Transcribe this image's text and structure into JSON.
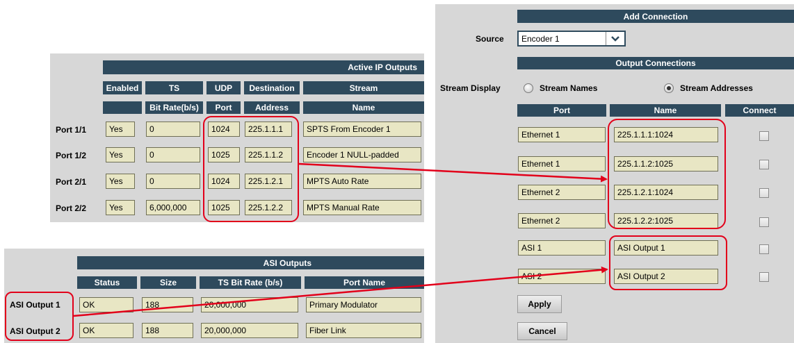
{
  "ip_outputs": {
    "title": "Active IP Outputs",
    "columns": [
      {
        "top": "Enabled",
        "bottom": ""
      },
      {
        "top": "TS",
        "bottom": "Bit Rate(b/s)"
      },
      {
        "top": "UDP",
        "bottom": "Port"
      },
      {
        "top": "Destination",
        "bottom": "Address"
      },
      {
        "top": "Stream",
        "bottom": "Name"
      }
    ],
    "rows": [
      {
        "label": "Port 1/1",
        "enabled": "Yes",
        "bitrate": "0",
        "udp": "1024",
        "address": "225.1.1.1",
        "name": "SPTS From Encoder 1"
      },
      {
        "label": "Port 1/2",
        "enabled": "Yes",
        "bitrate": "0",
        "udp": "1025",
        "address": "225.1.1.2",
        "name": "Encoder 1 NULL-padded"
      },
      {
        "label": "Port 2/1",
        "enabled": "Yes",
        "bitrate": "0",
        "udp": "1024",
        "address": "225.1.2.1",
        "name": "MPTS Auto Rate"
      },
      {
        "label": "Port 2/2",
        "enabled": "Yes",
        "bitrate": "6,000,000",
        "udp": "1025",
        "address": "225.1.2.2",
        "name": "MPTS Manual Rate"
      }
    ]
  },
  "asi_outputs": {
    "title": "ASI Outputs",
    "columns": [
      "Status",
      "Size",
      "TS Bit Rate (b/s)",
      "Port Name"
    ],
    "rows": [
      {
        "label": "ASI Output 1",
        "status": "OK",
        "size": "188",
        "bitrate": "20,000,000",
        "port_name": "Primary Modulator"
      },
      {
        "label": "ASI Output 2",
        "status": "OK",
        "size": "188",
        "bitrate": "20,000,000",
        "port_name": "Fiber Link"
      }
    ]
  },
  "add_connection": {
    "title": "Add Connection",
    "source_label": "Source",
    "source_value": "Encoder 1",
    "output_connections_title": "Output Connections",
    "stream_display_label": "Stream Display",
    "radio_names": "Stream Names",
    "radio_addresses": "Stream Addresses",
    "selected_display": "Stream Addresses",
    "columns": [
      "Port",
      "Name",
      "Connect"
    ],
    "rows": [
      {
        "port": "Ethernet 1",
        "name": "225.1.1.1:1024",
        "connected": false
      },
      {
        "port": "Ethernet 1",
        "name": "225.1.1.2:1025",
        "connected": false
      },
      {
        "port": "Ethernet 2",
        "name": "225.1.2.1:1024",
        "connected": false
      },
      {
        "port": "Ethernet 2",
        "name": "225.1.2.2:1025",
        "connected": false
      },
      {
        "port": "ASI 1",
        "name": "ASI Output 1",
        "connected": false
      },
      {
        "port": "ASI 2",
        "name": "ASI Output 2",
        "connected": false
      }
    ],
    "apply_label": "Apply",
    "cancel_label": "Cancel"
  },
  "colors": {
    "header_bg": "#2e4a5d",
    "panel_bg": "#d7d7d7",
    "field_bg": "#e8e6c4",
    "highlight": "#e2001a"
  }
}
